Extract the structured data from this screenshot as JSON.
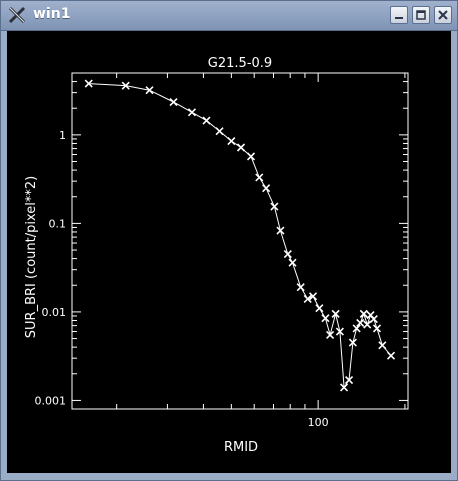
{
  "window": {
    "title": "win1"
  },
  "chart_data": {
    "type": "scatter",
    "title": "G21.5-0.9",
    "xlabel": "RMID",
    "ylabel": "SUR_BRI (count/pixel**2)",
    "xscale": "log",
    "yscale": "log",
    "xlim": [
      14,
      205
    ],
    "ylim": [
      0.0008,
      5
    ],
    "yticks": [
      {
        "value": 0.001,
        "label": "0.001"
      },
      {
        "value": 0.01,
        "label": "0.01"
      },
      {
        "value": 0.1,
        "label": "0.1"
      },
      {
        "value": 1,
        "label": "1"
      }
    ],
    "xticks": [
      {
        "value": 100,
        "label": "100"
      }
    ],
    "marker": "x",
    "connected": true,
    "color": "#ffffff",
    "background": "#000000",
    "points": [
      {
        "x": 16.0,
        "y": 3.8
      },
      {
        "x": 21.5,
        "y": 3.6
      },
      {
        "x": 26.0,
        "y": 3.2
      },
      {
        "x": 31.5,
        "y": 2.35
      },
      {
        "x": 36.5,
        "y": 1.8
      },
      {
        "x": 41.0,
        "y": 1.45
      },
      {
        "x": 45.5,
        "y": 1.1
      },
      {
        "x": 50.0,
        "y": 0.85
      },
      {
        "x": 54.0,
        "y": 0.72
      },
      {
        "x": 58.5,
        "y": 0.57
      },
      {
        "x": 62.5,
        "y": 0.33
      },
      {
        "x": 66.0,
        "y": 0.25
      },
      {
        "x": 70.5,
        "y": 0.155
      },
      {
        "x": 74.0,
        "y": 0.083
      },
      {
        "x": 78.5,
        "y": 0.045
      },
      {
        "x": 81.5,
        "y": 0.036
      },
      {
        "x": 87.0,
        "y": 0.019
      },
      {
        "x": 92.0,
        "y": 0.014
      },
      {
        "x": 96.0,
        "y": 0.015
      },
      {
        "x": 101.0,
        "y": 0.011
      },
      {
        "x": 106.0,
        "y": 0.0085
      },
      {
        "x": 110.0,
        "y": 0.0055
      },
      {
        "x": 115.0,
        "y": 0.0095
      },
      {
        "x": 119.0,
        "y": 0.006
      },
      {
        "x": 123.0,
        "y": 0.0014
      },
      {
        "x": 128.0,
        "y": 0.0017
      },
      {
        "x": 132.0,
        "y": 0.0045
      },
      {
        "x": 136.0,
        "y": 0.0065
      },
      {
        "x": 140.0,
        "y": 0.0075
      },
      {
        "x": 144.0,
        "y": 0.0095
      },
      {
        "x": 148.0,
        "y": 0.0072
      },
      {
        "x": 152.0,
        "y": 0.0092
      },
      {
        "x": 156.0,
        "y": 0.0083
      },
      {
        "x": 160.0,
        "y": 0.0065
      },
      {
        "x": 167.0,
        "y": 0.0042
      },
      {
        "x": 179.0,
        "y": 0.0032
      }
    ]
  }
}
